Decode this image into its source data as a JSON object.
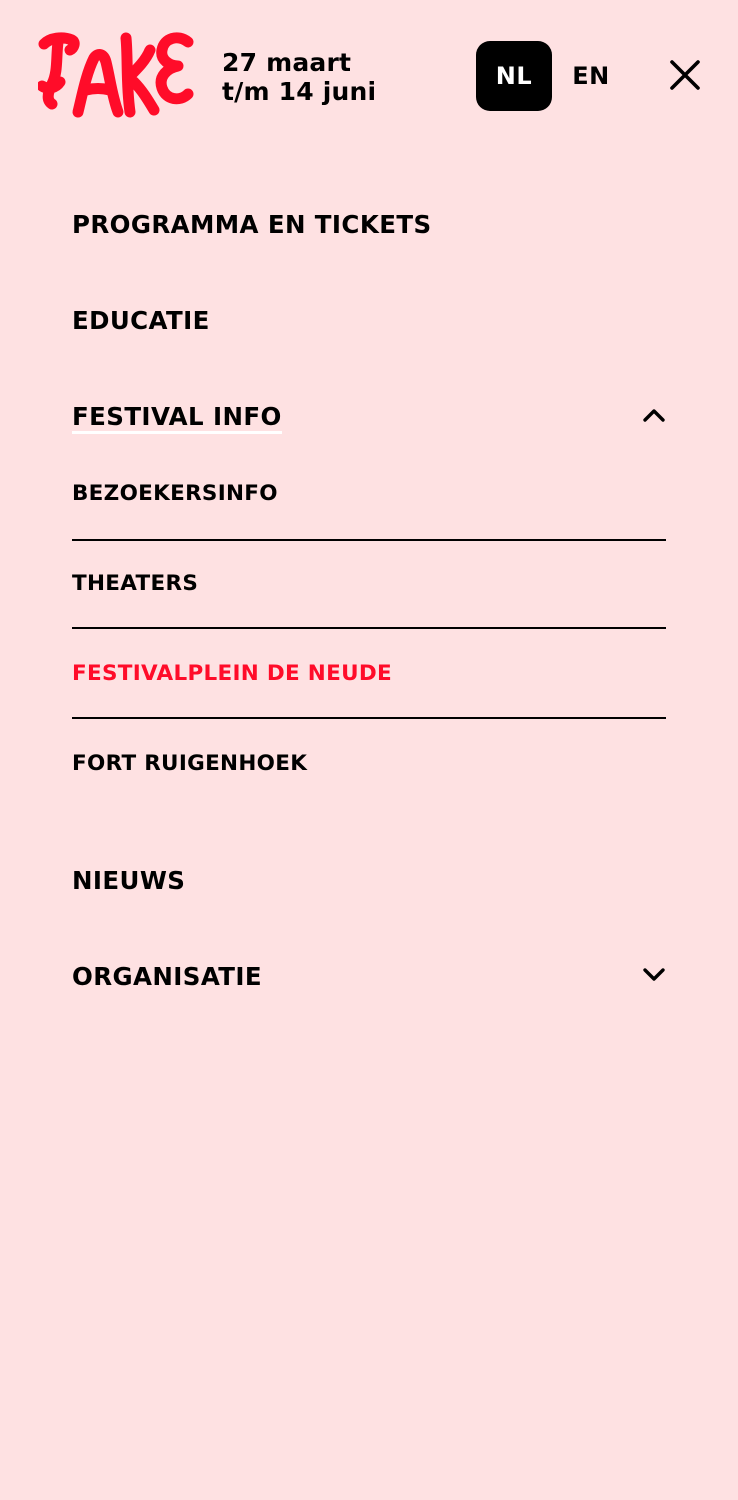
{
  "brand": {
    "logo_text": "TAAK",
    "logo_color": "#ff0c29"
  },
  "header": {
    "dates": [
      "27 maart",
      "t/m 14 juni"
    ],
    "languages": [
      {
        "label": "NL",
        "selected": true
      },
      {
        "label": "EN",
        "selected": false
      }
    ],
    "close_icon": "close-icon"
  },
  "menu": {
    "items": [
      {
        "label": "PROGRAMMA EN TICKETS"
      },
      {
        "label": "EDUCATIE"
      },
      {
        "label": "FESTIVAL INFO",
        "expanded": true,
        "icon": "chevron-up-icon",
        "subitems": [
          {
            "label": "BEZOEKERSINFO"
          },
          {
            "label": "THEATERS"
          },
          {
            "label": "FESTIVALPLEIN DE NEUDE",
            "current": true
          },
          {
            "label": "FORT RUIGENHOEK"
          }
        ]
      },
      {
        "label": "NIEUWS"
      },
      {
        "label": "ORGANISATIE",
        "expanded": false,
        "icon": "chevron-down-icon"
      }
    ]
  },
  "colors": {
    "background": "#fee1e2",
    "accent": "#ff0c29",
    "text": "#000000"
  }
}
